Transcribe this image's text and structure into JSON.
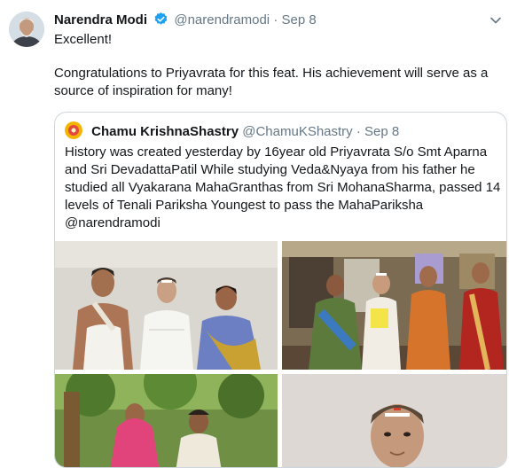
{
  "tweet": {
    "author_name": "Narendra Modi",
    "author_handle": "@narendramodi",
    "separator": "·",
    "date": "Sep 8",
    "line1": "Excellent!",
    "line2": "Congratulations to Priyavrata for this feat. His achievement will serve as a",
    "line3": "source of inspiration for many!"
  },
  "quoted": {
    "author_name": "Chamu KrishnaShastry",
    "author_handle": "@ChamuKShastry",
    "separator": "·",
    "date": "Sep 8",
    "lines": [
      "History was created yesterday by 16year old Priyavrata S/o Smt Aparna",
      "and Sri DevadattaPatil While studying Veda&Nyaya from his father he",
      "studied all Vyakarana MahaGranthas from Sri MohanaSharma, passed 14",
      "levels of Tenali Pariksha Youngest to pass the MahaPariksha",
      "@narendramodi"
    ]
  },
  "icons": {
    "verified": "verified-badge-icon",
    "caret": "chevron-down-icon"
  },
  "colors": {
    "verified": "#1da1f2",
    "secondary_text": "#657786",
    "border": "#ccd6dd"
  }
}
